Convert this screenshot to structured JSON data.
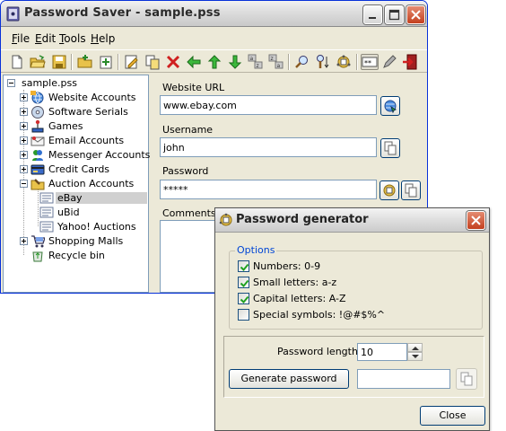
{
  "main_window": {
    "title": "Password Saver - sample.pss",
    "menu": [
      {
        "first": "F",
        "rest": "ile"
      },
      {
        "first": "E",
        "rest": "dit"
      },
      {
        "first": "T",
        "rest": "ools"
      },
      {
        "first": "H",
        "rest": "elp"
      }
    ],
    "toolbar": [
      "new-file-icon",
      "open-folder-icon",
      "save-icon",
      "add-category-icon",
      "add-item-icon",
      "edit-icon",
      "copy-item-icon",
      "delete-icon",
      "arrow-left-icon",
      "arrow-up-icon",
      "arrow-down-icon",
      "sort-az-icon",
      "sort-za-icon",
      "find-icon",
      "find-replace-icon",
      "password-generator-icon",
      "show-password-icon",
      "pencil-icon",
      "exit-icon"
    ]
  },
  "tree": {
    "root": "sample.pss",
    "categories": [
      {
        "label": "Website Accounts",
        "icon": "globe-icon"
      },
      {
        "label": "Software Serials",
        "icon": "cd-icon"
      },
      {
        "label": "Games",
        "icon": "joystick-icon"
      },
      {
        "label": "Email Accounts",
        "icon": "envelope-icon"
      },
      {
        "label": "Messenger Accounts",
        "icon": "messenger-icon"
      },
      {
        "label": "Credit Cards",
        "icon": "credit-card-icon"
      },
      {
        "label": "Auction Accounts",
        "icon": "auction-folder-icon"
      }
    ],
    "auction_items": [
      {
        "label": "eBay",
        "selected": true
      },
      {
        "label": "uBid",
        "selected": false
      },
      {
        "label": "Yahoo! Auctions",
        "selected": false
      }
    ],
    "tail": [
      {
        "label": "Shopping Malls",
        "icon": "shopping-cart-icon"
      },
      {
        "label": "Recycle bin",
        "icon": "recycle-bin-icon"
      }
    ]
  },
  "details": {
    "url_label": "Website URL",
    "url_value": "www.ebay.com",
    "username_label": "Username",
    "username_value": "john",
    "password_label": "Password",
    "password_value": "*****",
    "comments_label": "Comments"
  },
  "dialog": {
    "title": "Password generator",
    "options_legend": "Options",
    "options": [
      {
        "label": "Numbers: 0-9",
        "checked": true
      },
      {
        "label": "Small letters: a-z",
        "checked": true
      },
      {
        "label": "Capital letters: A-Z",
        "checked": true
      },
      {
        "label": "Special symbols: !@#$%^",
        "checked": false
      }
    ],
    "length_label": "Password length:",
    "length_value": "10",
    "generate_label": "Generate password",
    "close_label": "Close"
  },
  "colors": {
    "accent_legend": "#0046d5",
    "selection": "#d0d0d0",
    "window_bg": "#ece9d8",
    "close_button": "#c3401f"
  }
}
